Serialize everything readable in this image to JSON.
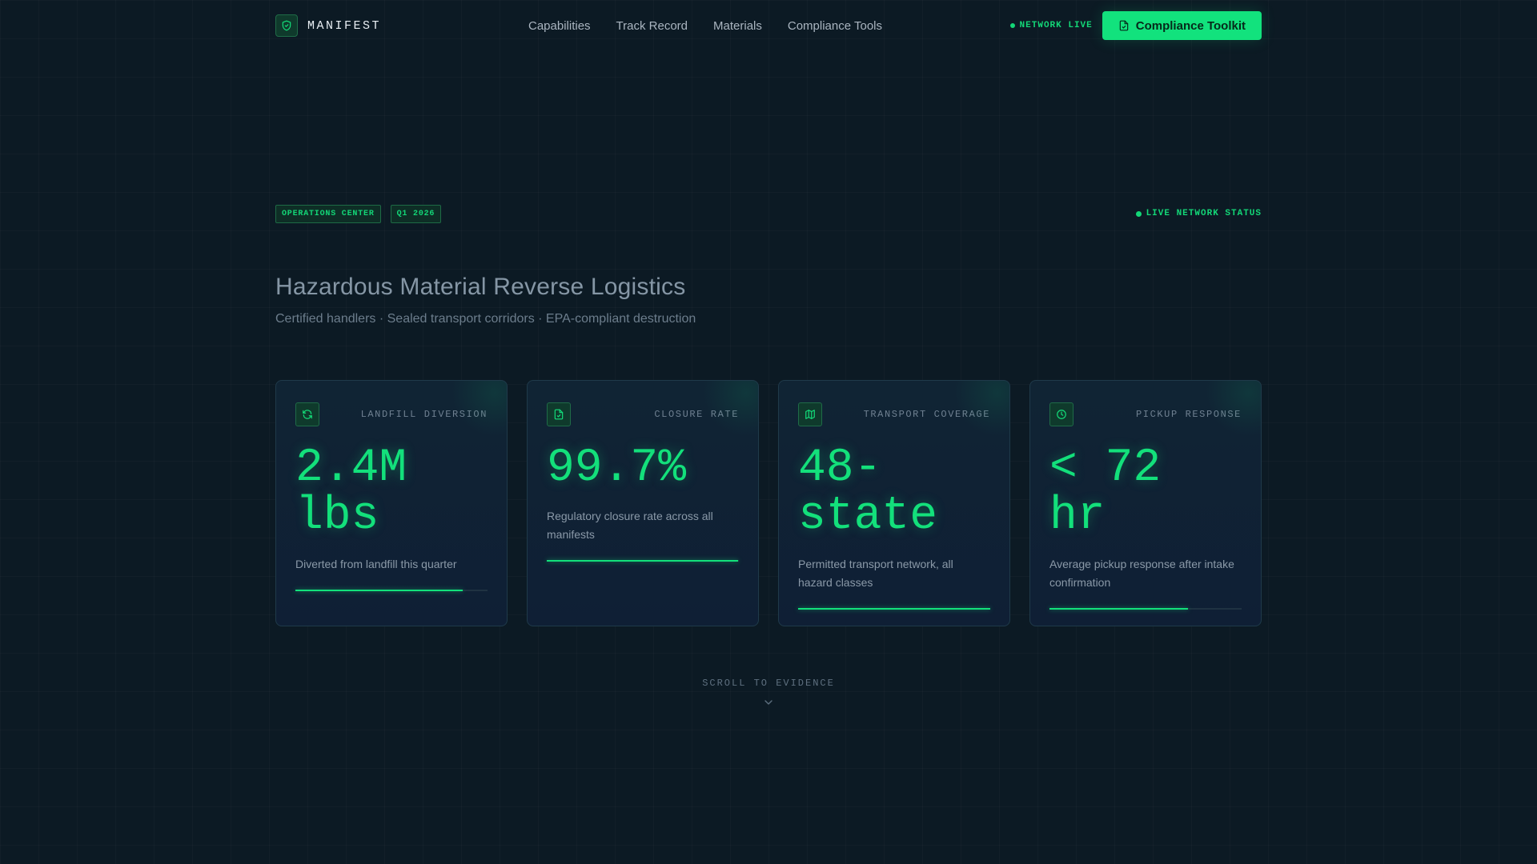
{
  "header": {
    "brand": "MANIFEST",
    "nav": [
      "Capabilities",
      "Track Record",
      "Materials",
      "Compliance Tools"
    ],
    "status": "NETWORK LIVE",
    "cta_label": "Compliance Toolkit"
  },
  "hero": {
    "tags": [
      "OPERATIONS CENTER",
      "Q1 2026"
    ],
    "status": "LIVE NETWORK STATUS",
    "title": "Hazardous Material Reverse Logistics",
    "subtitle": "Certified handlers · Sealed transport corridors · EPA-compliant destruction"
  },
  "cards": [
    {
      "icon": "refresh-icon",
      "label": "LANDFILL DIVERSION",
      "value": "2.4M lbs",
      "description": "Diverted from landfill this quarter",
      "progress": 0.87
    },
    {
      "icon": "document-icon",
      "label": "CLOSURE RATE",
      "value": "99.7%",
      "description": "Regulatory closure rate across all manifests",
      "progress": 0.997
    },
    {
      "icon": "map-icon",
      "label": "TRANSPORT COVERAGE",
      "value": "48-state",
      "description": "Permitted transport network, all hazard classes",
      "progress": 1.0
    },
    {
      "icon": "clock-icon",
      "label": "PICKUP RESPONSE",
      "value": "< 72 hr",
      "description": "Average pickup response after intake confirmation",
      "progress": 0.72
    }
  ],
  "scroll_hint": "SCROLL TO EVIDENCE",
  "colors": {
    "accent": "#13e07b",
    "background": "#0c1a24",
    "card": "#102434",
    "muted": "#6f8091"
  }
}
